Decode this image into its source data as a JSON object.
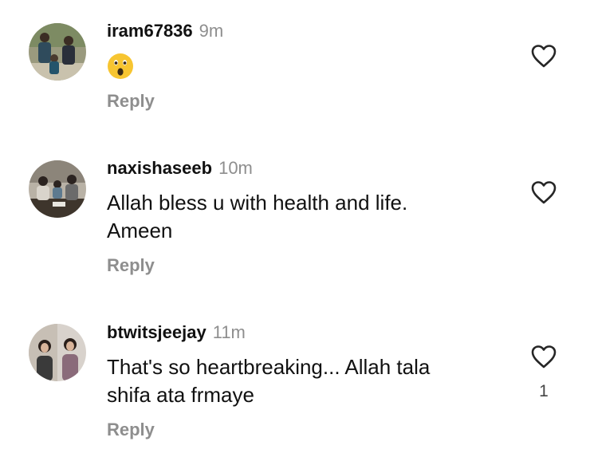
{
  "comments": [
    {
      "username": "iram67836",
      "time": "9m",
      "text": "",
      "emoji_icon": "astonished-face-emoji",
      "reply_label": "Reply",
      "like_icon": "heart-outline-icon",
      "like_count": ""
    },
    {
      "username": "naxishaseeb",
      "time": "10m",
      "text_lines": [
        "Allah bless u with health and life.",
        "Ameen"
      ],
      "reply_label": "Reply",
      "like_icon": "heart-outline-icon",
      "like_count": ""
    },
    {
      "username": "btwitsjeejay",
      "time": "11m",
      "text_lines": [
        "That's so heartbreaking... Allah tala",
        "shifa ata frmaye"
      ],
      "reply_label": "Reply",
      "like_icon": "heart-outline-icon",
      "like_count": "1"
    }
  ],
  "colors": {
    "primary_text": "#111111",
    "secondary_text": "#8e8e8e",
    "emoji_yellow": "#f7c531"
  }
}
